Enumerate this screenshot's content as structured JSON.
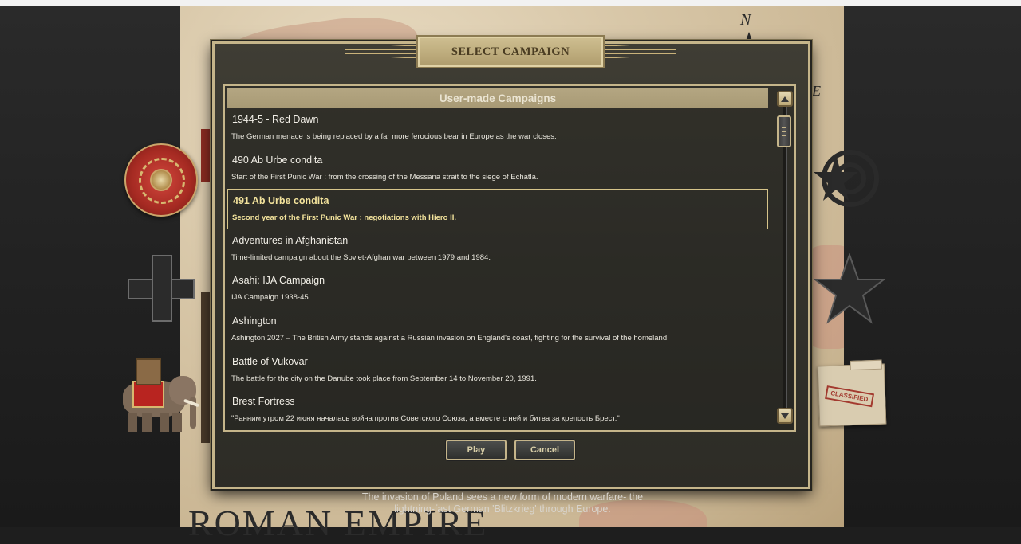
{
  "dialog": {
    "title": "SELECT CAMPAIGN",
    "list_header": "User-made Campaigns",
    "selected_index": 2,
    "campaigns": [
      {
        "name": "1944-5 - Red Dawn",
        "description": "The German menace is being replaced by a far more ferocious bear in Europe as the war closes."
      },
      {
        "name": "490 Ab Urbe condita",
        "description": "Start of the First Punic War : from the crossing of the Messana strait to the siege of Echatla."
      },
      {
        "name": "491 Ab Urbe condita",
        "description": "Second year of the First Punic War : negotiations with Hiero II."
      },
      {
        "name": "Adventures in Afghanistan",
        "description": "Time-limited campaign about the Soviet-Afghan war between 1979 and 1984."
      },
      {
        "name": "Asahi: IJA Campaign",
        "description": "IJA Campaign 1938-45"
      },
      {
        "name": "Ashington",
        "description": "Ashington 2027 – The British Army stands against a Russian invasion on England's coast, fighting for the survival of the homeland."
      },
      {
        "name": "Battle of Vukovar",
        "description": "The battle for the city on the Danube took place from September 14 to November 20, 1991."
      },
      {
        "name": "Brest Fortress",
        "description": "\"Ранним утром 22 июня началась война против Советского Союза, а вместе с ней и битва за крепость Брест.\""
      }
    ],
    "buttons": {
      "play": "Play",
      "cancel": "Cancel"
    }
  },
  "background": {
    "map_title": "ROMAN EMPIRE",
    "caption_line1": "The invasion of Poland sees a new form of modern warfare- the",
    "caption_line2": "lightning-fast German 'Blitzkrieg' through Europe.",
    "compass_north": "N",
    "compass_east": "E",
    "folder_stamp": "CLASSIFIED"
  },
  "colors": {
    "dialog_border": "#c5b58a",
    "selected_text": "#f3e39c",
    "header_bg": "#a89a75"
  }
}
